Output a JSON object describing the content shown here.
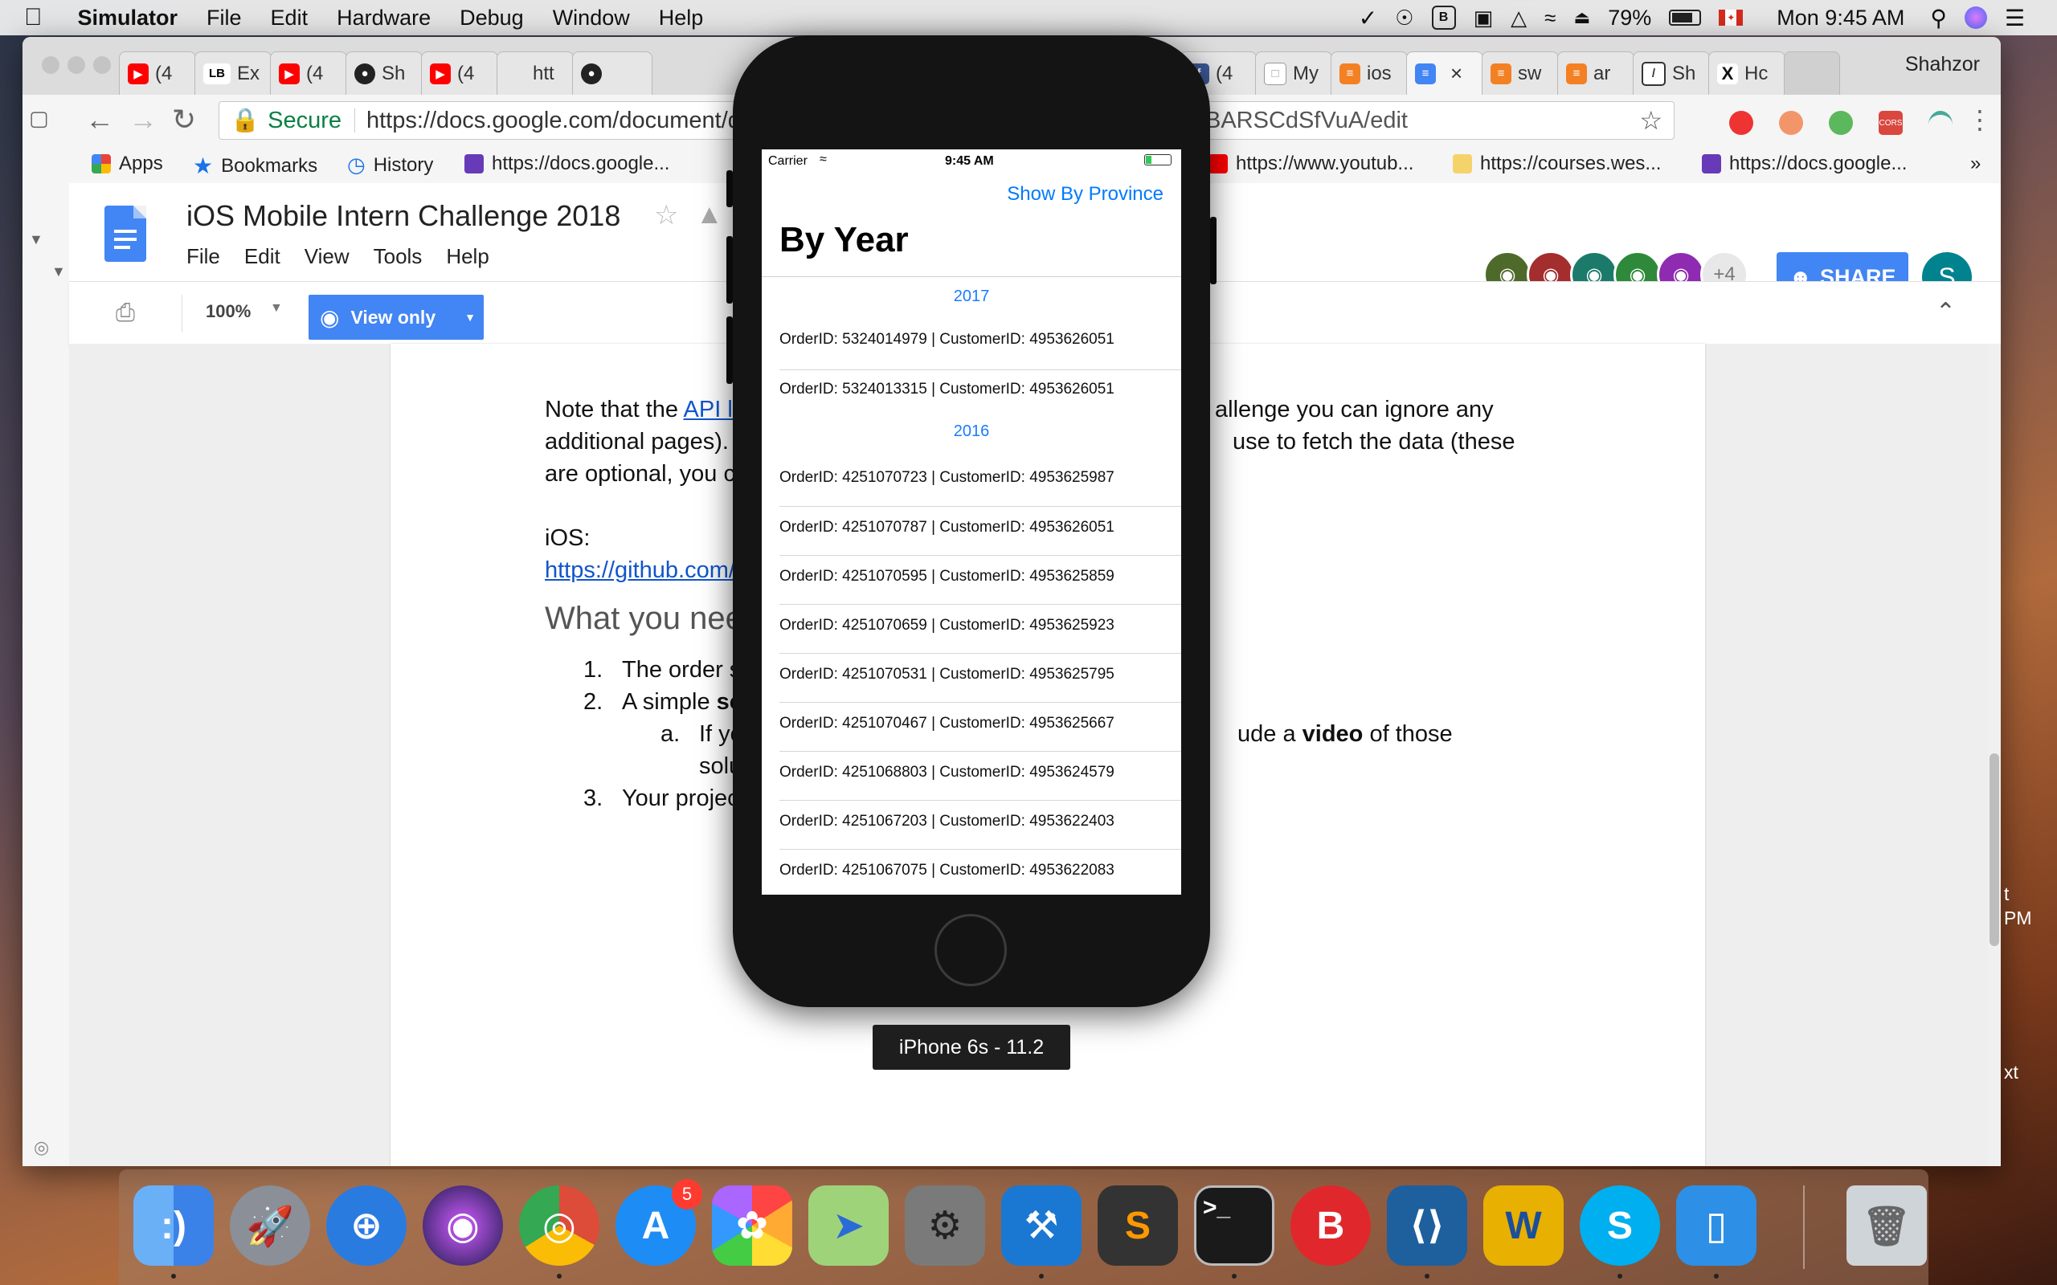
{
  "menubar": {
    "app": "Simulator",
    "items": [
      "File",
      "Edit",
      "Hardware",
      "Debug",
      "Window",
      "Help"
    ],
    "battery": "79%",
    "clock": "Mon 9:45 AM"
  },
  "chrome": {
    "tabs": [
      {
        "title": "(4",
        "icon": "youtube-icon",
        "color": "#ff0000"
      },
      {
        "title": "Ex",
        "icon": "lb-icon",
        "color": "#ffffff"
      },
      {
        "title": "(4",
        "icon": "youtube-icon",
        "color": "#ff0000"
      },
      {
        "title": "Sh",
        "icon": "github-icon",
        "color": "#222222"
      },
      {
        "title": "(4",
        "icon": "youtube-icon",
        "color": "#ff0000"
      },
      {
        "title": "htt",
        "icon": "blank-icon",
        "color": "#dddddd"
      },
      {
        "title": "(4",
        "icon": "facebook-icon",
        "color": "#3b5998"
      },
      {
        "title": "My",
        "icon": "doc-icon",
        "color": "#cccccc"
      },
      {
        "title": "ios",
        "icon": "stackoverflow-icon",
        "color": "#f48024"
      },
      {
        "title": "",
        "icon": "docs-icon",
        "color": "#4285f4"
      },
      {
        "title": "sw",
        "icon": "stackoverflow-icon",
        "color": "#f48024"
      },
      {
        "title": "ar",
        "icon": "stackoverflow-icon",
        "color": "#f48024"
      },
      {
        "title": "Sh",
        "icon": "shopify-icon",
        "color": "#333333"
      },
      {
        "title": "Hc",
        "icon": "x-icon",
        "color": "#333333"
      }
    ],
    "profile": "Shahzor",
    "omnibox": {
      "secure": "Secure",
      "url": "https://docs.google.com/document/d",
      "url_tail": "BARSCdSfVuA/edit"
    },
    "bookmarks": [
      {
        "label": "Apps"
      },
      {
        "label": "Bookmarks"
      },
      {
        "label": "History"
      },
      {
        "label": "https://docs.google..."
      },
      {
        "label": "https://www.youtub..."
      },
      {
        "label": "https://courses.wes..."
      },
      {
        "label": "https://docs.google..."
      }
    ],
    "more": "»"
  },
  "docs": {
    "title": "iOS Mobile Intern Challenge 2018",
    "menus": [
      "File",
      "Edit",
      "View",
      "Tools",
      "Help"
    ],
    "collaborators_extra": "+4",
    "share": "SHARE",
    "user_initial": "S",
    "zoom": "100%",
    "view_mode": "View only",
    "body": {
      "p1_a": "Note that the ",
      "p1_link": "API lin",
      "p1_b": "allenge you can ignore any",
      "p2_a": "additional pages). H",
      "p2_b": "use to fetch the data (these",
      "p3_a": "are optional, you can",
      "ios_label": "iOS:",
      "ios_link": "https://github.com/Al",
      "heading": "What you need",
      "list": [
        {
          "num": "1.",
          "text": "The order su"
        },
        {
          "num": "2.",
          "text": "A simple ",
          "bold": "scr"
        },
        {
          "num": "a.",
          "text": "If you",
          "tail_a": "ude a ",
          "tail_bold": "video",
          "tail_b": " of those"
        },
        {
          "num": "",
          "text": "soluti"
        },
        {
          "num": "3.",
          "text": "Your project"
        }
      ]
    }
  },
  "simulator": {
    "status": {
      "carrier": "Carrier",
      "time": "9:45 AM"
    },
    "nav_right": "Show By Province",
    "nav_title": "By Year",
    "sections": [
      {
        "year": "2017",
        "orders": [
          "OrderID: 5324014979 | CustomerID: 4953626051",
          "OrderID: 5324013315 | CustomerID: 4953626051"
        ]
      },
      {
        "year": "2016",
        "orders": [
          "OrderID: 4251070723 | CustomerID: 4953625987",
          "OrderID: 4251070787 | CustomerID: 4953626051",
          "OrderID: 4251070595 | CustomerID: 4953625859",
          "OrderID: 4251070659 | CustomerID: 4953625923",
          "OrderID: 4251070531 | CustomerID: 4953625795",
          "OrderID: 4251070467 | CustomerID: 4953625667",
          "OrderID: 4251068803 | CustomerID: 4953624579",
          "OrderID: 4251067203 | CustomerID: 4953622403",
          "OrderID: 4251067075 | CustomerID: 4953622083"
        ]
      }
    ],
    "device_label": "iPhone 6s - 11.2"
  },
  "dock": {
    "apps": [
      {
        "name": "finder",
        "color": "#3d8ff5",
        "glyph": ":)"
      },
      {
        "name": "launchpad",
        "color": "#8a8f98",
        "glyph": "🚀"
      },
      {
        "name": "safari",
        "color": "#2a7be0",
        "glyph": "⊕"
      },
      {
        "name": "siri",
        "color": "#3a2a6e",
        "glyph": "◉"
      },
      {
        "name": "chrome",
        "color": "#dd4b39",
        "glyph": "◎"
      },
      {
        "name": "app-store",
        "color": "#1e8cf5",
        "glyph": "A",
        "badge": "5"
      },
      {
        "name": "photos",
        "color": "#f7f7f7",
        "glyph": "✿"
      },
      {
        "name": "maps",
        "color": "#9fd37a",
        "glyph": "➤"
      },
      {
        "name": "system-preferences",
        "color": "#7a7a7a",
        "glyph": "⚙"
      },
      {
        "name": "xcode",
        "color": "#1b78d2",
        "glyph": "⚒"
      },
      {
        "name": "sublime-text",
        "color": "#333333",
        "glyph": "S"
      },
      {
        "name": "terminal",
        "color": "#1a1a1a",
        "glyph": ">_"
      },
      {
        "name": "brave",
        "color": "#e0282c",
        "glyph": "B"
      },
      {
        "name": "vscode",
        "color": "#1e5f9e",
        "glyph": "⟨⟩"
      },
      {
        "name": "wmail",
        "color": "#e8b000",
        "glyph": "W"
      },
      {
        "name": "skype",
        "color": "#00aff0",
        "glyph": "S"
      },
      {
        "name": "simulator",
        "color": "#2d8fe6",
        "glyph": "▯"
      },
      {
        "name": "trash",
        "color": "#cfd4d8",
        "glyph": "🗑"
      }
    ]
  },
  "desktop": {
    "peek_1": "t",
    "peek_2": "PM",
    "peek_3": "xt"
  }
}
